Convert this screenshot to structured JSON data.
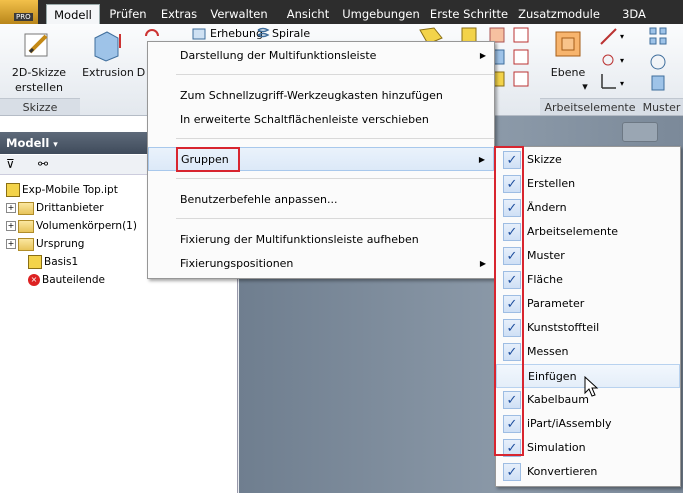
{
  "app": {
    "badge": "PRO"
  },
  "tabs": [
    "Modell",
    "Prüfen",
    "Extras",
    "Verwalten",
    "Ansicht",
    "Umgebungen",
    "Erste Schritte",
    "Zusatzmodule",
    "3DA"
  ],
  "ribbon": {
    "sketch_line1": "2D-Skizze",
    "sketch_line2": "erstellen",
    "extrusion": "Extrusion",
    "d_label": "D",
    "erhebung": "Erhebung",
    "spirale": "Spirale",
    "ebene": "Ebene",
    "panel_skizze": "Skizze",
    "panel_arbeitselemente": "Arbeitselemente",
    "panel_muster": "Muster"
  },
  "browser": {
    "title": "Modell",
    "tree": [
      {
        "label": "Exp-Mobile Top.ipt",
        "expander": ""
      },
      {
        "label": "Drittanbieter",
        "expander": "+"
      },
      {
        "label": "Volumenkörpern(1)",
        "expander": "+"
      },
      {
        "label": "Ursprung",
        "expander": "+"
      },
      {
        "label": "Basis1",
        "expander": ""
      },
      {
        "label": "Bauteilende",
        "expander": ""
      }
    ]
  },
  "menu": {
    "items": [
      {
        "label": "Darstellung der Multifunktionsleiste",
        "arrow": "▶"
      },
      {
        "label": "Zum Schnellzugriff-Werkzeugkasten hinzufügen"
      },
      {
        "label": "In erweiterte Schaltflächenleiste verschieben"
      },
      {
        "label": "Gruppen",
        "arrow": "▶"
      },
      {
        "label": "Benutzerbefehle anpassen..."
      },
      {
        "label": "Fixierung der Multifunktionsleiste aufheben"
      },
      {
        "label": "Fixierungspositionen",
        "arrow": "▶"
      }
    ]
  },
  "submenu": {
    "check": "✓",
    "items": [
      {
        "label": "Skizze",
        "checked": true
      },
      {
        "label": "Erstellen",
        "checked": true
      },
      {
        "label": "Ändern",
        "checked": true
      },
      {
        "label": "Arbeitselemente",
        "checked": true
      },
      {
        "label": "Muster",
        "checked": true
      },
      {
        "label": "Fläche",
        "checked": true
      },
      {
        "label": "Parameter",
        "checked": true
      },
      {
        "label": "Kunststoffteil",
        "checked": true
      },
      {
        "label": "Messen",
        "checked": true
      },
      {
        "label": "Einfügen",
        "checked": false
      },
      {
        "label": "Kabelbaum",
        "checked": true
      },
      {
        "label": "iPart/iAssembly",
        "checked": true
      },
      {
        "label": "Simulation",
        "checked": true
      },
      {
        "label": "Konvertieren",
        "checked": true
      }
    ]
  },
  "colors": {
    "highlight_box": "#d8252f",
    "accent": "#1f4f9e"
  }
}
